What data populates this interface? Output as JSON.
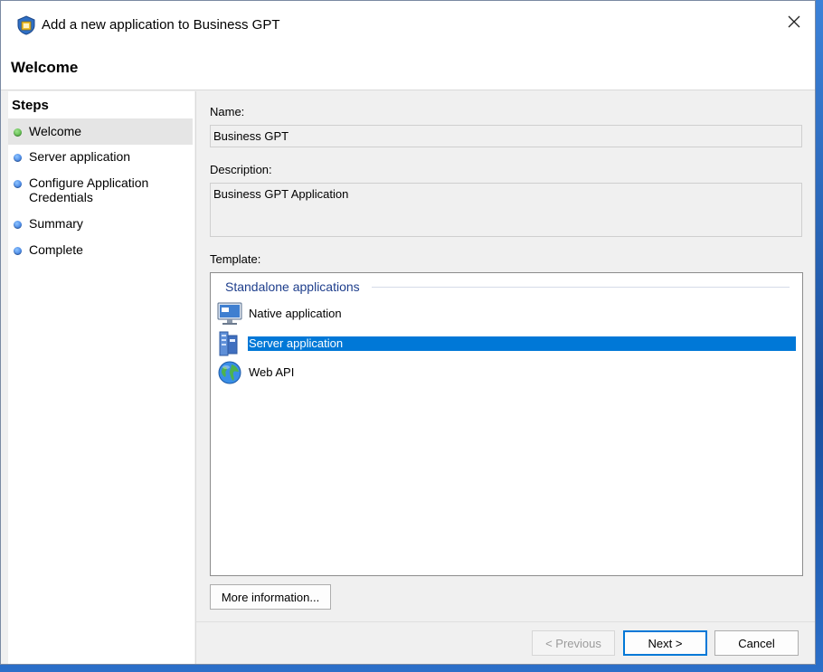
{
  "window": {
    "title": "Add a new application to Business GPT",
    "close_label": "Close"
  },
  "header": {
    "title": "Welcome"
  },
  "steps": {
    "title": "Steps",
    "items": [
      {
        "label": "Welcome",
        "status": "current"
      },
      {
        "label": "Server application",
        "status": "pending"
      },
      {
        "label": "Configure Application Credentials",
        "status": "pending"
      },
      {
        "label": "Summary",
        "status": "pending"
      },
      {
        "label": "Complete",
        "status": "pending"
      }
    ]
  },
  "form": {
    "name_label": "Name:",
    "name_value": "Business GPT",
    "description_label": "Description:",
    "description_value": "Business GPT Application",
    "template_label": "Template:",
    "template_group": "Standalone applications",
    "templates": [
      {
        "label": "Native application",
        "icon": "native-application-icon",
        "selected": false
      },
      {
        "label": "Server application",
        "icon": "server-application-icon",
        "selected": true
      },
      {
        "label": "Web API",
        "icon": "web-api-globe-icon",
        "selected": false
      }
    ],
    "more_info_label": "More information..."
  },
  "footer": {
    "previous_label": "< Previous",
    "next_label": "Next >",
    "cancel_label": "Cancel"
  },
  "colors": {
    "selection": "#0078d7",
    "group_header": "#1e3e8c",
    "step_current": "#3ca72a",
    "step_pending": "#1e63d6"
  }
}
